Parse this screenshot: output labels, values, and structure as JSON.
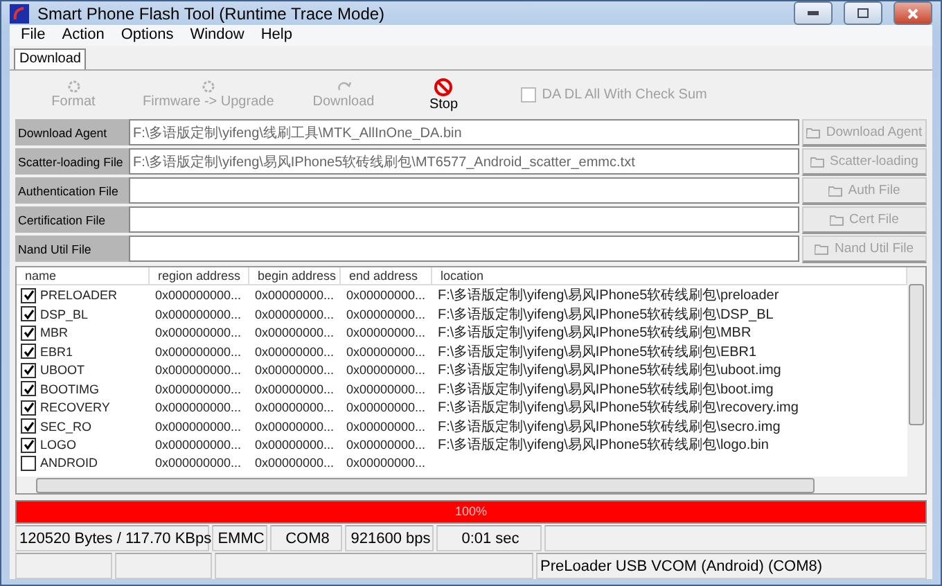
{
  "window": {
    "title": "Smart Phone Flash Tool (Runtime Trace Mode)"
  },
  "menu": [
    "File",
    "Action",
    "Options",
    "Window",
    "Help"
  ],
  "tabs": [
    {
      "label": "Download",
      "selected": true
    }
  ],
  "toolbar": [
    {
      "label": "Format",
      "disabled": true
    },
    {
      "label": "Firmware -> Upgrade",
      "disabled": true
    },
    {
      "label": "Download",
      "disabled": true
    },
    {
      "label": "Stop",
      "disabled": false
    }
  ],
  "check_sum": {
    "label": "DA DL All With Check Sum",
    "checked": false,
    "disabled": true
  },
  "files": [
    {
      "label": "Download Agent",
      "value": "F:\\多语版定制\\yifeng\\线刷工具\\MTK_AllInOne_DA.bin",
      "button": "Download Agent"
    },
    {
      "label": "Scatter-loading File",
      "value": "F:\\多语版定制\\yifeng\\易风IPhone5软砖线刷包\\MT6577_Android_scatter_emmc.txt",
      "button": "Scatter-loading"
    },
    {
      "label": "Authentication File",
      "button": "Auth File"
    },
    {
      "label": "Certification File",
      "button": "Cert File"
    },
    {
      "label": "Nand Util File",
      "button": "Nand Util File"
    }
  ],
  "table": {
    "columns": [
      "name",
      "region address",
      "begin address",
      "end address",
      "location"
    ],
    "rows": [
      {
        "name": "PRELOADER",
        "checked": true,
        "region": "0x000000000...",
        "begin": "0x00000000...",
        "end": "0x00000000...",
        "location": "F:\\多语版定制\\yifeng\\易风IPhone5软砖线刷包\\preloader"
      },
      {
        "name": "DSP_BL",
        "checked": true,
        "region": "0x000000000...",
        "begin": "0x00000000...",
        "end": "0x00000000...",
        "location": "F:\\多语版定制\\yifeng\\易风IPhone5软砖线刷包\\DSP_BL"
      },
      {
        "name": "MBR",
        "checked": true,
        "region": "0x000000000...",
        "begin": "0x00000000...",
        "end": "0x00000000...",
        "location": "F:\\多语版定制\\yifeng\\易风IPhone5软砖线刷包\\MBR"
      },
      {
        "name": "EBR1",
        "checked": true,
        "region": "0x000000000...",
        "begin": "0x00000000...",
        "end": "0x00000000...",
        "location": "F:\\多语版定制\\yifeng\\易风IPhone5软砖线刷包\\EBR1"
      },
      {
        "name": "UBOOT",
        "checked": true,
        "region": "0x000000000...",
        "begin": "0x00000000...",
        "end": "0x00000000...",
        "location": "F:\\多语版定制\\yifeng\\易风IPhone5软砖线刷包\\uboot.img"
      },
      {
        "name": "BOOTIMG",
        "checked": true,
        "region": "0x000000000...",
        "begin": "0x00000000...",
        "end": "0x00000000...",
        "location": "F:\\多语版定制\\yifeng\\易风IPhone5软砖线刷包\\boot.img"
      },
      {
        "name": "RECOVERY",
        "checked": true,
        "region": "0x000000000...",
        "begin": "0x00000000...",
        "end": "0x00000000...",
        "location": "F:\\多语版定制\\yifeng\\易风IPhone5软砖线刷包\\recovery.img"
      },
      {
        "name": "SEC_RO",
        "checked": true,
        "region": "0x000000000...",
        "begin": "0x00000000...",
        "end": "0x00000000...",
        "location": "F:\\多语版定制\\yifeng\\易风IPhone5软砖线刷包\\secro.img"
      },
      {
        "name": "LOGO",
        "checked": true,
        "region": "0x000000000...",
        "begin": "0x00000000...",
        "end": "0x00000000...",
        "location": "F:\\多语版定制\\yifeng\\易风IPhone5软砖线刷包\\logo.bin"
      },
      {
        "name": "ANDROID",
        "checked": false,
        "region": "0x000000000...",
        "begin": "0x00000000...",
        "end": "0x00000000..."
      }
    ]
  },
  "progress": {
    "level": 1,
    "label": "100%"
  },
  "status_bar": [
    [
      "120520 Bytes / 117.70 KBps",
      "EMMC",
      "COM8",
      "921600 bps",
      "0:01 sec"
    ],
    [
      "PreLoader USB VCOM (Android) (COM8)"
    ]
  ]
}
